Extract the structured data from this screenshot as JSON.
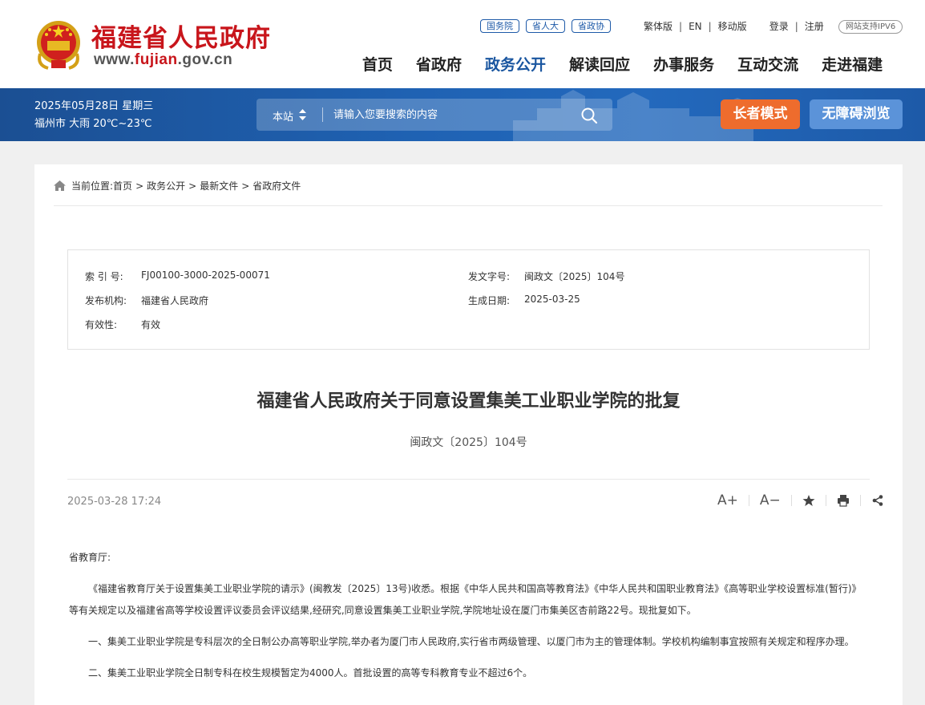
{
  "header": {
    "site_name": "福建省人民政府",
    "url_prefix": "www.",
    "url_highlight": "fujian",
    "url_suffix": ".gov.cn",
    "tags": [
      "国务院",
      "省人大",
      "省政协"
    ],
    "links": {
      "traditional": "繁体版",
      "en": "EN",
      "mobile": "移动版",
      "login": "登录",
      "register": "注册"
    },
    "ipv6": "网站支持IPV6",
    "nav": [
      "首页",
      "省政府",
      "政务公开",
      "解读回应",
      "办事服务",
      "互动交流",
      "走进福建"
    ],
    "active_nav": "政务公开"
  },
  "bluebar": {
    "date": "2025年05月28日 星期三",
    "weather": "福州市 大雨 20℃~23℃",
    "search_scope": "本站",
    "search_placeholder": "请输入您要搜索的内容",
    "elder_mode": "长者模式",
    "accessible": "无障碍浏览"
  },
  "breadcrumb": {
    "prefix": "当前位置:",
    "items": [
      "首页",
      "政务公开",
      "最新文件",
      "省政府文件"
    ]
  },
  "meta": {
    "index_label": "索 引 号:",
    "index_value": "FJ00100-3000-2025-00071",
    "docnum_label": "发文字号:",
    "docnum_value": "闽政文〔2025〕104号",
    "issuer_label": "发布机构:",
    "issuer_value": "福建省人民政府",
    "date_label": "生成日期:",
    "date_value": "2025-03-25",
    "validity_label": "有效性:",
    "validity_value": "有效"
  },
  "article": {
    "title": "福建省人民政府关于同意设置集美工业职业学院的批复",
    "doc_number": "闽政文〔2025〕104号",
    "published": "2025-03-28 17:24",
    "tools": {
      "font_up": "A+",
      "font_down": "A−"
    },
    "paragraphs": [
      "省教育厅:",
      "《福建省教育厅关于设置集美工业职业学院的请示》(闽教发〔2025〕13号)收悉。根据《中华人民共和国高等教育法》《中华人民共和国职业教育法》《高等职业学校设置标准(暂行)》等有关规定以及福建省高等学校设置评议委员会评议结果,经研究,同意设置集美工业职业学院,学院地址设在厦门市集美区杏前路22号。现批复如下。",
      "一、集美工业职业学院是专科层次的全日制公办高等职业学院,举办者为厦门市人民政府,实行省市两级管理、以厦门市为主的管理体制。学校机构编制事宜按照有关规定和程序办理。",
      "二、集美工业职业学院全日制专科在校生规模暂定为4000人。首批设置的高等专科教育专业不超过6个。"
    ]
  },
  "colors": {
    "brand_red": "#c8151b",
    "nav_blue": "#1a56a0",
    "bar_blue": "#1f62b3",
    "elder_orange": "#ee6c2d",
    "access_blue": "#5b93d9"
  }
}
